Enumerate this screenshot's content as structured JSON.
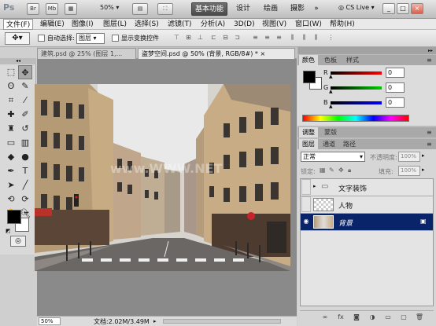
{
  "appbar": {
    "logo": "Ps",
    "br_label": "Br",
    "mb_label": "Mb",
    "zoom": "50%",
    "workspaces": [
      "基本功能",
      "设计",
      "绘画",
      "摄影"
    ],
    "more": "»",
    "cslive": "CS Live",
    "min": "_",
    "max": "□",
    "close": "×"
  },
  "menubar": {
    "items": [
      "文件(F)",
      "编辑(E)",
      "图像(I)",
      "图层(L)",
      "选择(S)",
      "滤镜(T)",
      "分析(A)",
      "3D(D)",
      "视图(V)",
      "窗口(W)",
      "帮助(H)"
    ]
  },
  "options": {
    "auto_select_label": "自动选择:",
    "auto_select_value": "图层",
    "show_transform_label": "显示变换控件"
  },
  "doc_tabs": [
    {
      "label": "建筑.psd @ 25% (图层 1,..."
    },
    {
      "label": "盗梦空间.psd @ 50% (背景, RGB/8#) *"
    }
  ],
  "status": {
    "zoom": "50%",
    "doc": "文档:2.02M/3.49M"
  },
  "watermark": "www.WWW.NET",
  "color_panel": {
    "tabs": [
      "颜色",
      "色板",
      "样式"
    ],
    "channels": [
      {
        "label": "R",
        "value": "0",
        "color": "#e00000"
      },
      {
        "label": "G",
        "value": "0",
        "color": "#00b000"
      },
      {
        "label": "B",
        "value": "0",
        "color": "#0000e0"
      }
    ]
  },
  "adjust_panel": {
    "tabs": [
      "调整",
      "蒙版"
    ]
  },
  "layers_panel": {
    "tabs": [
      "图层",
      "通道",
      "路径"
    ],
    "blend_mode": "正常",
    "opacity_label": "不透明度:",
    "opacity_value": "100%",
    "lock_label": "锁定:",
    "fill_label": "填充:",
    "fill_value": "100%",
    "layers": [
      {
        "name": "文字装饰",
        "type": "group",
        "visible": false,
        "selected": false
      },
      {
        "name": "人物",
        "type": "layer",
        "visible": false,
        "selected": false
      },
      {
        "name": "背景",
        "type": "background",
        "visible": true,
        "selected": true
      }
    ]
  },
  "colors": {
    "accent_dark": "#0a246a",
    "panel": "#bcbcbc"
  }
}
